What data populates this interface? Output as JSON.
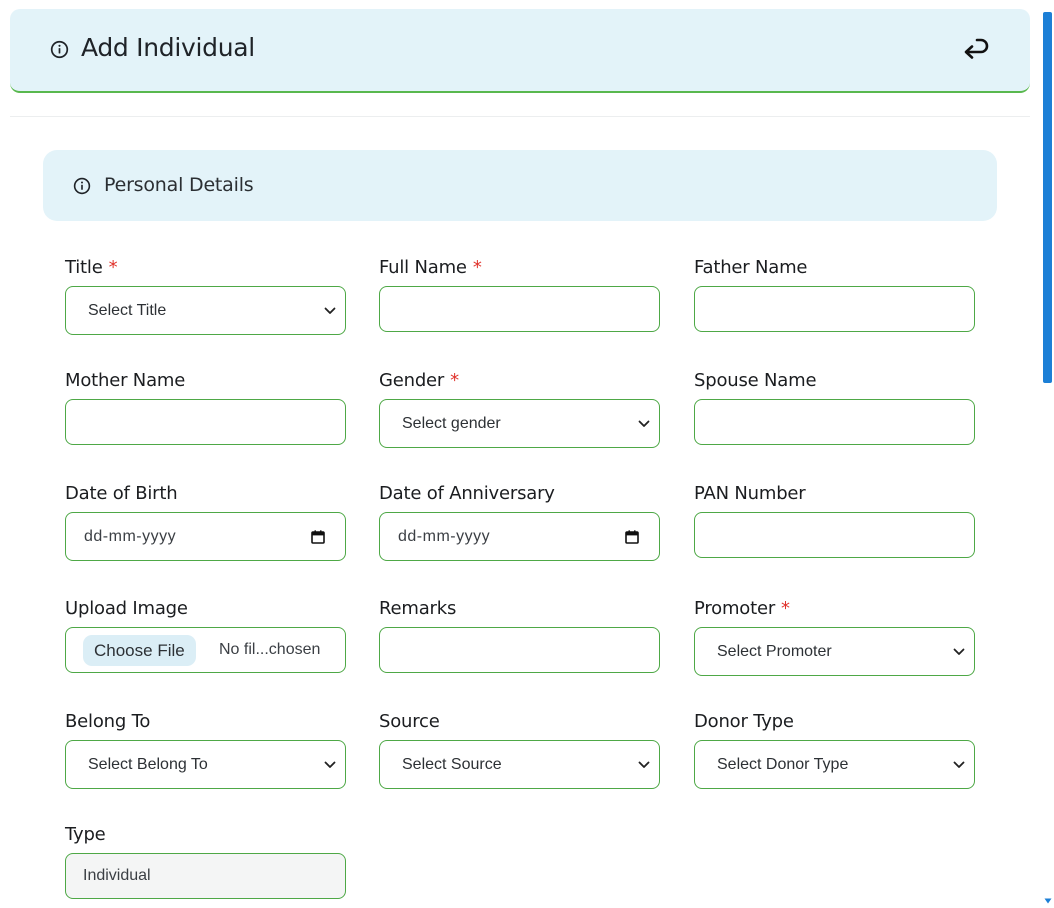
{
  "header": {
    "title": "Add Individual",
    "info_icon": "info-circle-icon",
    "back_icon": "return-arrow-icon"
  },
  "section": {
    "title": "Personal Details",
    "info_icon": "info-circle-icon"
  },
  "fields": {
    "title": {
      "label": "Title",
      "required_mark": "*",
      "value": "Select Title"
    },
    "full_name": {
      "label": "Full Name",
      "required_mark": "*",
      "value": ""
    },
    "father_name": {
      "label": "Father Name",
      "value": ""
    },
    "mother_name": {
      "label": "Mother Name",
      "value": ""
    },
    "gender": {
      "label": "Gender",
      "required_mark": "*",
      "value": "Select gender"
    },
    "spouse_name": {
      "label": "Spouse Name",
      "value": ""
    },
    "date_of_birth": {
      "label": "Date of Birth",
      "placeholder": "dd-mm-yyyy"
    },
    "date_of_anniversary": {
      "label": "Date of Anniversary",
      "placeholder": "dd-mm-yyyy"
    },
    "pan_number": {
      "label": "PAN Number",
      "value": ""
    },
    "upload_image": {
      "label": "Upload Image",
      "button": "Choose File",
      "status": "No fil...chosen"
    },
    "remarks": {
      "label": "Remarks",
      "value": ""
    },
    "promoter": {
      "label": "Promoter",
      "required_mark": "*",
      "value": "Select Promoter"
    },
    "belong_to": {
      "label": "Belong To",
      "value": "Select Belong To"
    },
    "source": {
      "label": "Source",
      "value": "Select Source"
    },
    "donor_type": {
      "label": "Donor Type",
      "value": "Select Donor Type"
    },
    "type": {
      "label": "Type",
      "value": "Individual"
    }
  },
  "colors": {
    "card_bg": "#e3f3f9",
    "field_border": "#4ea846",
    "required": "#e0322b",
    "scrollbar": "#1c7fd6"
  }
}
